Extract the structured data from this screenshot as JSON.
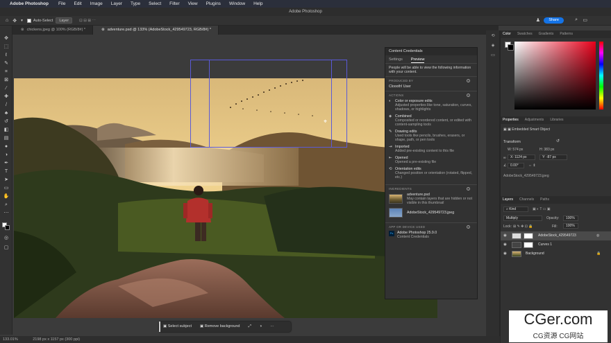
{
  "menubar": {
    "app_name": "Adobe Photoshop",
    "items": [
      "File",
      "Edit",
      "Image",
      "Layer",
      "Type",
      "Select",
      "Filter",
      "View",
      "Plugins",
      "Window",
      "Help"
    ]
  },
  "titlebar": {
    "title": "Adobe Photoshop"
  },
  "options": {
    "auto_select": "Auto-Select",
    "target": "Layer",
    "share": "Share"
  },
  "tabs": [
    {
      "label": "chickens.jpeg @ 100% (RGB/8#) *"
    },
    {
      "label": "adventure.psd @ 133% (AdobeStock_429549723, RGB/8#) *"
    }
  ],
  "status": {
    "zoom": "133.01%",
    "doc": "2198 px x 1157 px (300 ppi)"
  },
  "context_bar": {
    "select_subject": "Select subject",
    "remove_background": "Remove background",
    "more": "···"
  },
  "content_credentials": {
    "title": "Content Credentials",
    "tabs": [
      "Settings",
      "Preview"
    ],
    "intro": "People will be able to view the following information with your content.",
    "produced_by_h": "PRODUCED BY",
    "produced_by": "Cloooth! User",
    "actions_h": "ACTIONS",
    "actions": [
      {
        "title": "Color or exposure edits",
        "desc": "Adjusted properties like tone, saturation, curves, shadows, or highlights"
      },
      {
        "title": "Combined",
        "desc": "Composited or reordered content, or edited with content-sampling tools"
      },
      {
        "title": "Drawing edits",
        "desc": "Used tools like pencils, brushes, erasers, or shape, path, or pen tools"
      },
      {
        "title": "Imported",
        "desc": "Added pre-existing content to this file"
      },
      {
        "title": "Opened",
        "desc": "Opened a pre-existing file"
      },
      {
        "title": "Orientation edits",
        "desc": "Changed position or orientation (rotated, flipped, etc.)"
      }
    ],
    "ingredients_h": "INGREDIENTS",
    "ingredients": [
      {
        "title": "adventure.psd",
        "desc": "May contain layers that are hidden or not visible in this thumbnail"
      },
      {
        "title": "AdobeStock_429549723.jpeg",
        "desc": ""
      }
    ],
    "device_h": "APP OR DEVICE USED",
    "device": "Adobe Photoshop 25.9.0",
    "device_sub": "Content Credentials"
  },
  "color_panel": {
    "tabs": [
      "Color",
      "Swatches",
      "Gradients",
      "Patterns"
    ]
  },
  "properties": {
    "tabs": [
      "Properties",
      "Adjustments",
      "Libraries"
    ],
    "kind": "Embedded Smart Object",
    "transform_h": "Transform",
    "w": "W: 574 px",
    "h": "H: 383 px",
    "x": "X: 1124 px",
    "y": "Y: -87 px",
    "angle": "0.00°",
    "source": "AdobeStock_429549723.jpeg"
  },
  "layers": {
    "tabs": [
      "Layers",
      "Channels",
      "Paths"
    ],
    "filter": "Kind",
    "blend": "Multiply",
    "opacity_label": "Opacity:",
    "opacity": "100%",
    "lock_label": "Lock:",
    "fill_label": "Fill:",
    "fill": "100%",
    "items": [
      {
        "name": "AdobeStock_429549723"
      },
      {
        "name": "Curves 1"
      },
      {
        "name": "Background"
      }
    ]
  },
  "watermark": {
    "big": "CGer.com",
    "small": "CG资源 CG网站"
  },
  "colors": {
    "accent": "#1473e6",
    "panel": "#323232",
    "selection": "#5a5ad8"
  }
}
